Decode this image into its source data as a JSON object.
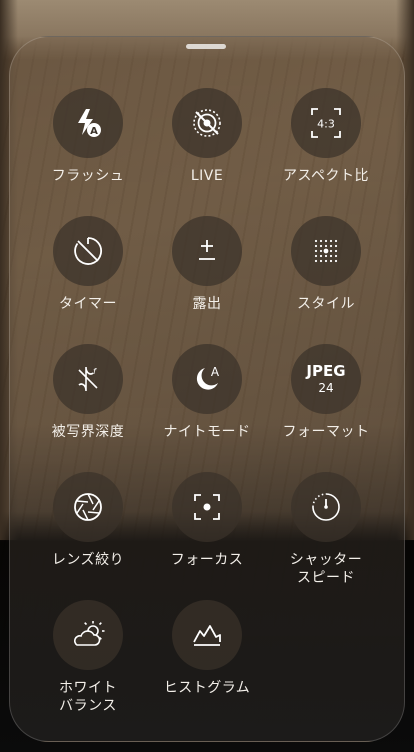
{
  "controls": [
    {
      "label": "フラッシュ",
      "icon": "flash-auto-icon"
    },
    {
      "label": "LIVE",
      "icon": "live-off-icon"
    },
    {
      "label": "アスペクト比",
      "icon": "aspect-ratio-icon",
      "badge": "4:3"
    },
    {
      "label": "タイマー",
      "icon": "timer-off-icon"
    },
    {
      "label": "露出",
      "icon": "exposure-icon"
    },
    {
      "label": "スタイル",
      "icon": "style-grid-icon"
    },
    {
      "label": "被写界深度",
      "icon": "depth-off-icon"
    },
    {
      "label": "ナイトモード",
      "icon": "night-mode-icon",
      "badge": "A"
    },
    {
      "label": "フォーマット",
      "icon": "format-icon",
      "format_main": "JPEG",
      "format_sub": "24"
    },
    {
      "label": "レンズ絞り",
      "icon": "aperture-icon"
    },
    {
      "label": "フォーカス",
      "icon": "focus-icon"
    },
    {
      "label": "シャッター\nスピード",
      "icon": "shutter-speed-icon"
    },
    {
      "label": "ホワイト\nバランス",
      "icon": "white-balance-icon"
    },
    {
      "label": "ヒストグラム",
      "icon": "histogram-icon"
    }
  ]
}
